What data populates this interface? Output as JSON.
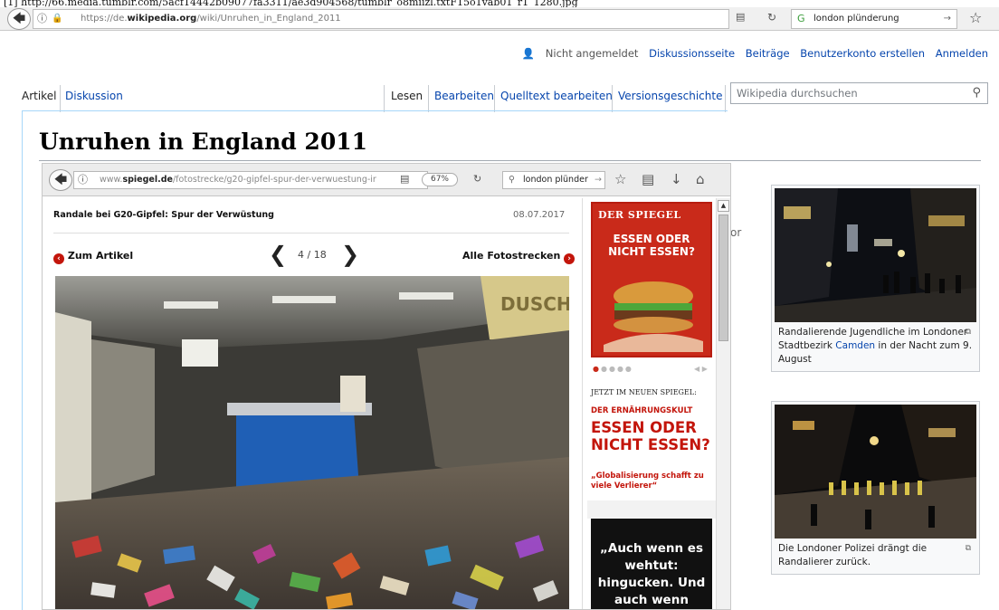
{
  "caption": "[1] http://66.media.tumblr.com/5acf14442b09077fa3311/ae3d904568/tumblr_o8miizl.txtF15o1vab01_r1_1280.jpg",
  "outer_browser": {
    "url_host": "https://de.",
    "url_domain": "wikipedia.org",
    "url_path": "/wiki/Unruhen_in_England_2011",
    "search_value": "london plünderung"
  },
  "personal_tools": {
    "not_logged_in": "Nicht angemeldet",
    "talk": "Diskussionsseite",
    "contributions": "Beiträge",
    "create_account": "Benutzerkonto erstellen",
    "login": "Anmelden"
  },
  "tabs": {
    "article": "Artikel",
    "discussion": "Diskussion",
    "read": "Lesen",
    "edit": "Bearbeiten",
    "edit_source": "Quelltext bearbeiten",
    "history": "Versionsgeschichte"
  },
  "wiki_search_placeholder": "Wikipedia durchsuchen",
  "page_title": "Unruhen in England 2011",
  "stray_text": "or",
  "inner_browser": {
    "url_host": "www.",
    "url_domain": "spiegel.de",
    "url_path": "/fotostrecke/g20-gipfel-spur-der-verwuestung-ir",
    "zoom": "67%",
    "search_value": "london plünder"
  },
  "spiegel": {
    "headline": "Randale bei G20-Gipfel: Spur der Verwüstung",
    "date": "08.07.2017",
    "back_link": "Zum Artikel",
    "counter": "4 / 18",
    "all_link": "Alle Fotostrecken",
    "photo_sign": "DUSCHE",
    "cover_logo": "DER SPIEGEL",
    "cover_title": "ESSEN ODER NICHT ESSEN?",
    "jetzt": "JETZT IM NEUEN SPIEGEL:",
    "kult": "DER ERNÄHRUNGSKULT",
    "big_red": "ESSEN ODER NICHT ESSEN?",
    "sub_red": "„Globalisierung schafft zu viele Verlierer“",
    "black_box": "„Auch wenn es wehtut: hingucken. Und auch wenn"
  },
  "thumbs": [
    {
      "caption_pre": "Randalierende Jugendliche im Londoner Stadtbezirk ",
      "caption_link": "Camden",
      "caption_post": " in der Nacht zum 9. August"
    },
    {
      "caption_pre": "Die Londoner Polizei drängt die Randalierer zurück.",
      "caption_link": "",
      "caption_post": ""
    }
  ],
  "colors": {
    "link": "#0645ad",
    "spiegel_red": "#c3150b",
    "wiki_border": "#a7d7f9"
  }
}
